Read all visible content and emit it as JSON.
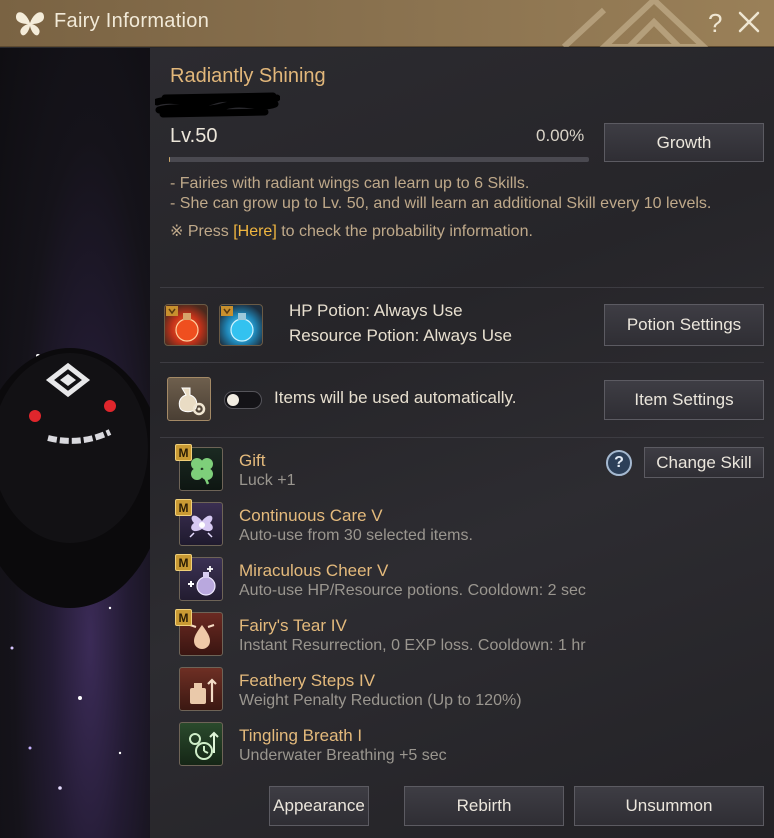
{
  "window": {
    "title": "Fairy Information",
    "help_label": "?"
  },
  "fairy": {
    "name": "Radiantly Shining",
    "level": "Lv.50",
    "growth_percent_label": "0.00%",
    "growth_fraction": 0.0,
    "growth_button": "Growth"
  },
  "info": {
    "line1": "- Fairies with radiant wings can learn up to 6 Skills.",
    "line2": "- She can grow up to Lv. 50, and will learn an additional Skill every 10 levels.",
    "line3_prefix": "※ Press ",
    "line3_link": "[Here]",
    "line3_suffix": " to check the probability information."
  },
  "potions": {
    "hp_text": "HP Potion: Always Use",
    "resource_text": "Resource Potion: Always Use",
    "button": "Potion Settings"
  },
  "items": {
    "auto_text": "Items will be used automatically.",
    "toggle_on": false,
    "button": "Item Settings"
  },
  "skills": {
    "change_button": "Change Skill",
    "help_label": "?",
    "list": [
      {
        "name": "Gift",
        "desc": "Luck +1",
        "badge": "M",
        "icon": "clover-icon"
      },
      {
        "name": "Continuous Care V",
        "desc": "Auto-use from 30 selected items.",
        "badge": "M",
        "icon": "fairy-care-icon"
      },
      {
        "name": "Miraculous Cheer V",
        "desc": "Auto-use HP/Resource potions. Cooldown: 2 sec",
        "badge": "M",
        "icon": "potion-cheer-icon"
      },
      {
        "name": "Fairy's Tear IV",
        "desc": "Instant Resurrection, 0 EXP loss. Cooldown: 1 hr",
        "badge": "M",
        "icon": "tear-icon"
      },
      {
        "name": "Feathery Steps IV",
        "desc": "Weight Penalty Reduction (Up to 120%)",
        "badge": "",
        "icon": "weight-icon"
      },
      {
        "name": "Tingling Breath I",
        "desc": "Underwater Breathing +5 sec",
        "badge": "",
        "icon": "bubble-icon"
      }
    ]
  },
  "footer": {
    "appearance": "Appearance",
    "rebirth": "Rebirth",
    "unsummon": "Unsummon"
  }
}
